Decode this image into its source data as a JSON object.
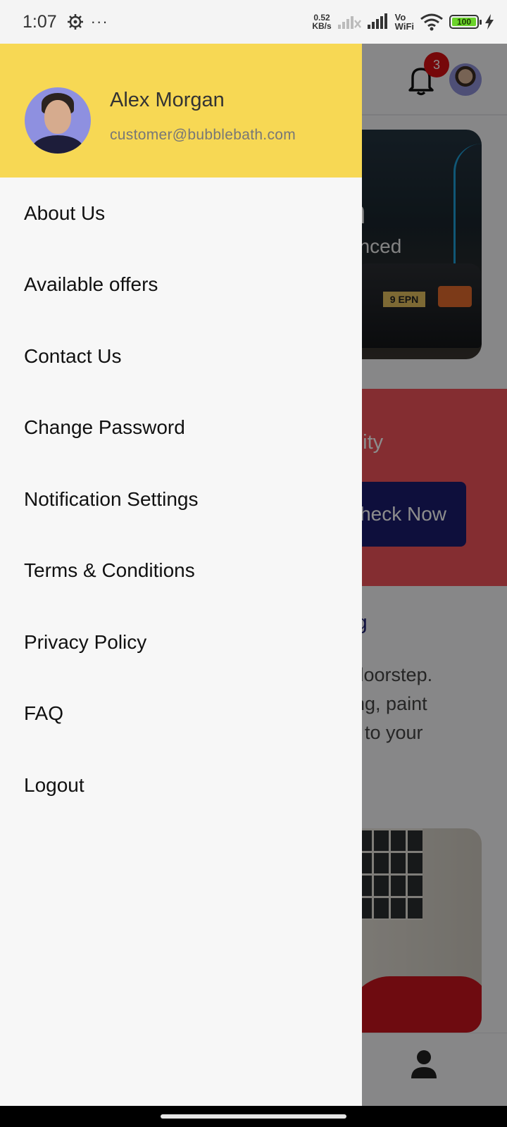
{
  "status_bar": {
    "time": "1:07",
    "net_speed_value": "0.52",
    "net_speed_unit": "KB/s",
    "vo_label": "Vo",
    "wifi_label": "WiFi",
    "battery_level": "100",
    "dots": "···"
  },
  "background_app": {
    "notification_count": "3",
    "hero_title_fragment": "n",
    "hero_subtitle_fragment": "anced",
    "plate_fragment": "9 EPN",
    "promo_text_fragment": "ability",
    "promo_button_fragment": "heck Now",
    "section_title_fragment": "iling",
    "section_body_fragment": "ur doorstep.\nailing, paint\nctly to your"
  },
  "drawer": {
    "user": {
      "name": "Alex Morgan",
      "email": "customer@bubblebath.com"
    },
    "menu_items": [
      {
        "label": "About Us"
      },
      {
        "label": "Available offers"
      },
      {
        "label": "Contact Us"
      },
      {
        "label": "Change Password"
      },
      {
        "label": "Notification Settings"
      },
      {
        "label": "Terms & Conditions"
      },
      {
        "label": "Privacy Policy"
      },
      {
        "label": "FAQ"
      },
      {
        "label": "Logout"
      }
    ]
  },
  "colors": {
    "drawer_header": "#f7d854",
    "promo_card": "#f0535a",
    "promo_button": "#1a1c6e",
    "notification_badge": "#d80f13"
  }
}
